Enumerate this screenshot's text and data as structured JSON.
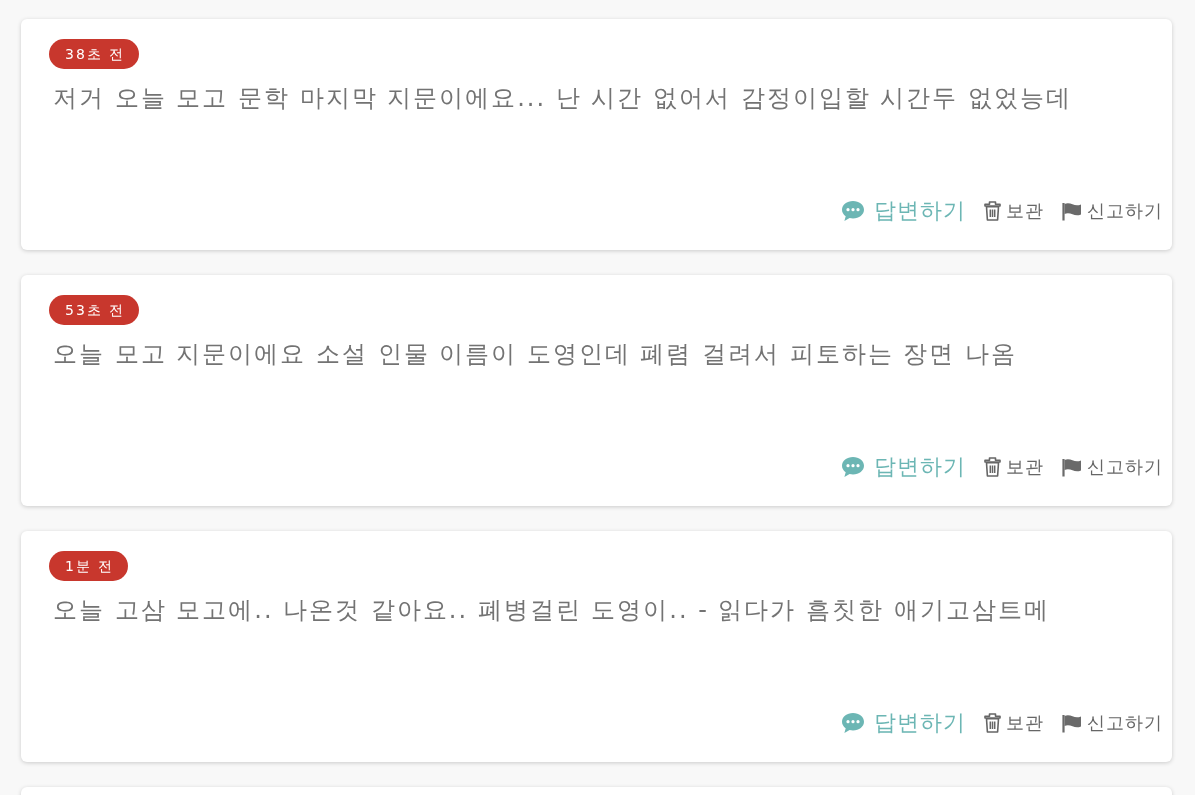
{
  "questions": [
    {
      "time": "38초 전",
      "text": "저거 오늘 모고 문학 마지막 지문이에요... 난 시간 없어서 감정이입할 시간두 없었능데",
      "actions": [
        {
          "kind": "answer",
          "label": "답변하기"
        },
        {
          "kind": "archive",
          "label": "보관"
        },
        {
          "kind": "report",
          "label": "신고하기"
        }
      ]
    },
    {
      "time": "53초 전",
      "text": "오늘 모고 지문이에요 소설 인물 이름이 도영인데 폐렴 걸려서 피토하는 장면 나옴",
      "actions": [
        {
          "kind": "answer",
          "label": "답변하기"
        },
        {
          "kind": "archive",
          "label": "보관"
        },
        {
          "kind": "report",
          "label": "신고하기"
        }
      ]
    },
    {
      "time": "1분 전",
      "text": "오늘 고삼 모고에.. 나온것 같아요.. 폐병걸린 도영이.. - 읽다가 흠칫한 애기고삼트메",
      "actions": [
        {
          "kind": "answer",
          "label": "답변하기"
        },
        {
          "kind": "archive",
          "label": "보관"
        },
        {
          "kind": "report",
          "label": "신고하기"
        }
      ]
    }
  ],
  "next_card_peek": true
}
